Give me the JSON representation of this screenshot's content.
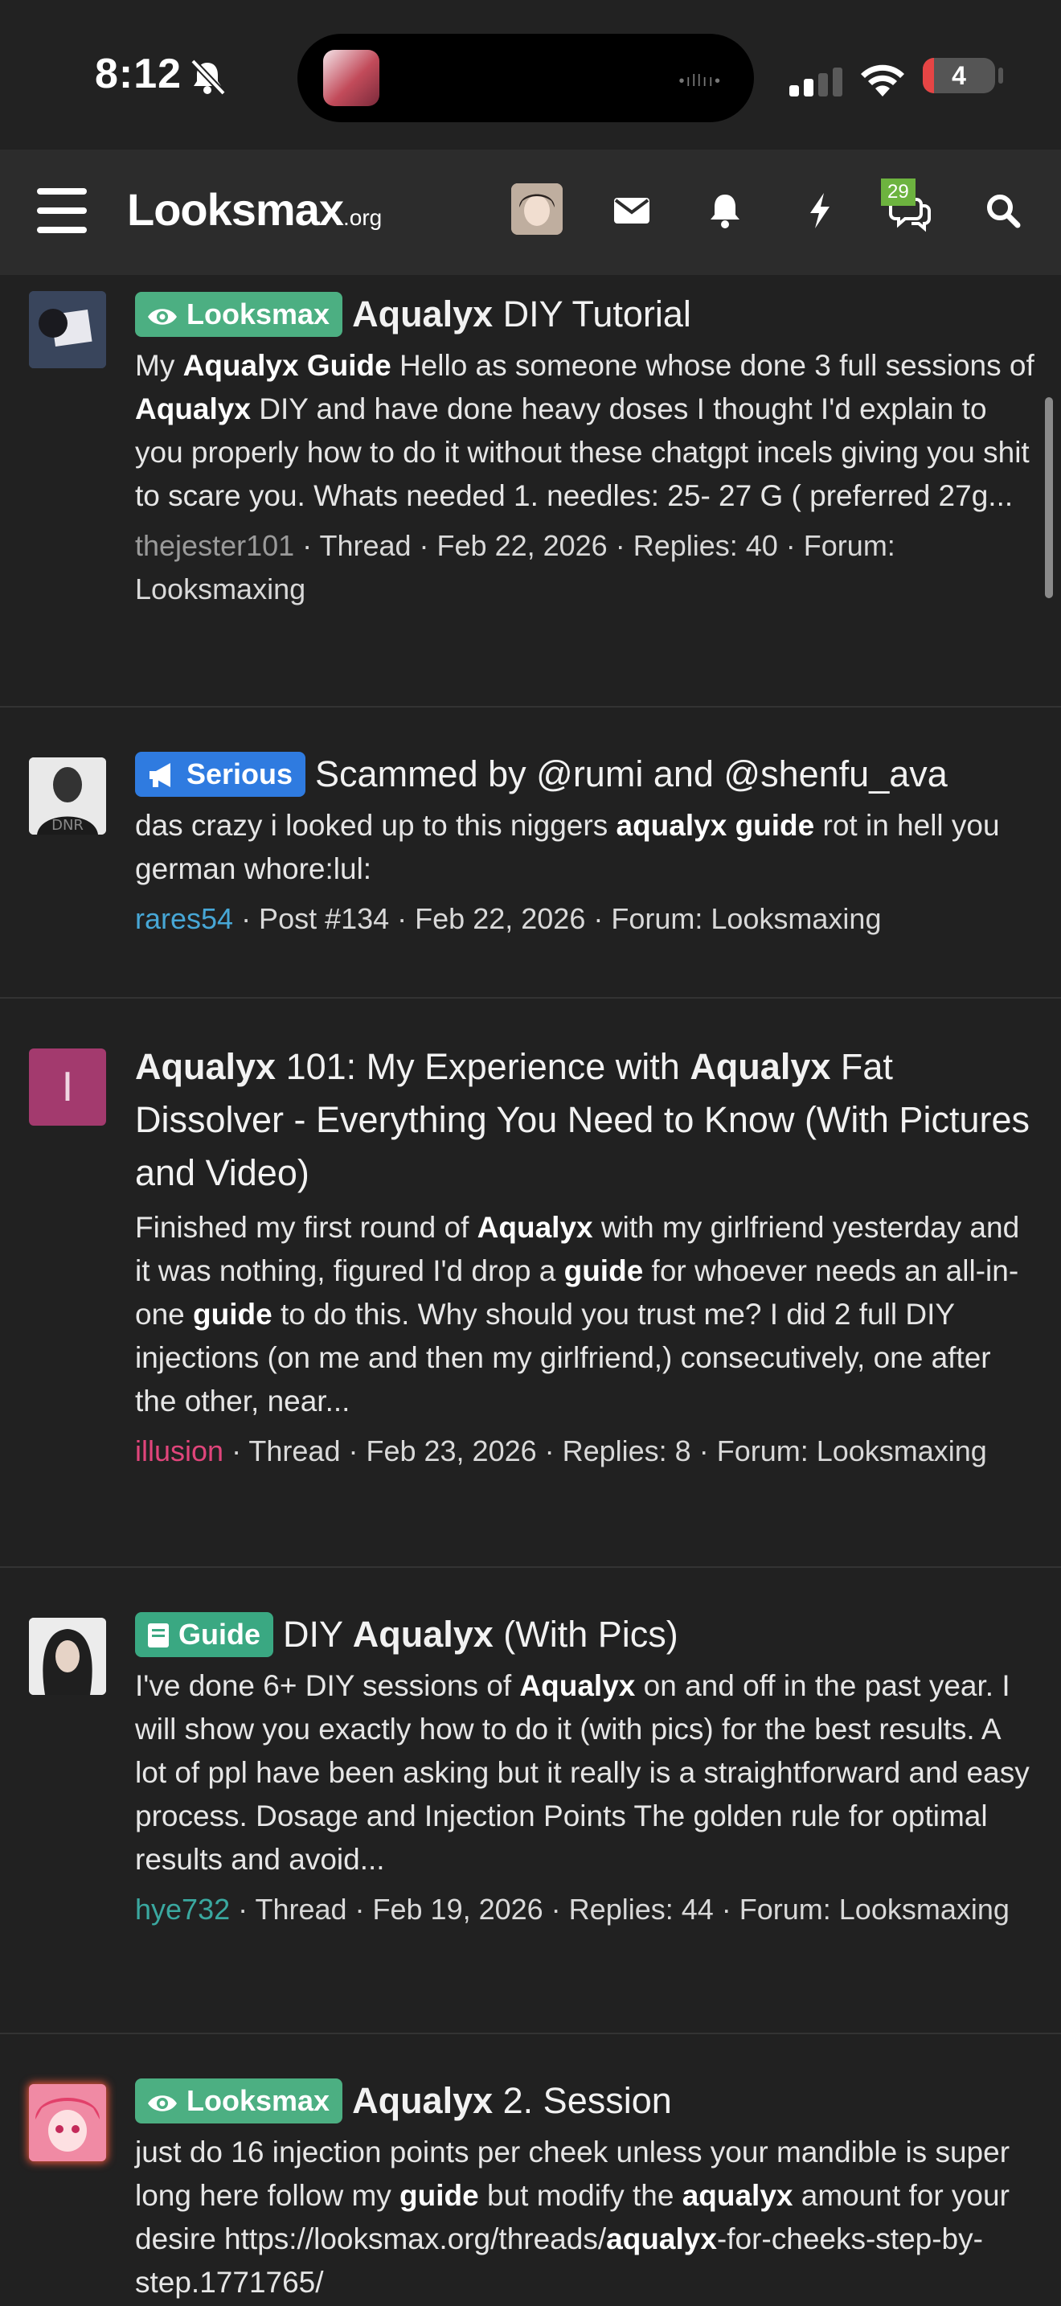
{
  "status_bar": {
    "time": "8:12",
    "battery": "4"
  },
  "navbar": {
    "logo_main": "Looksmax",
    "logo_suffix": ".org",
    "conversations_badge": "29"
  },
  "results": [
    {
      "avatar_color": "#5b6d8c",
      "prefix": {
        "label": "Looksmax",
        "color": "#4caf82",
        "icon": "eye-icon"
      },
      "title_parts": [
        {
          "t": "Aqualyx",
          "b": true
        },
        {
          "t": " DIY Tutorial",
          "b": false
        }
      ],
      "snippet_parts": [
        {
          "t": "My ",
          "b": false
        },
        {
          "t": "Aqualyx Guide",
          "b": true
        },
        {
          "t": " Hello as someone whose done 3 full sessions of ",
          "b": false
        },
        {
          "t": "Aqualyx",
          "b": true
        },
        {
          "t": " DIY and have done heavy doses I thought I'd explain to you properly how to do it without these chatgpt incels giving you shit to scare you. Whats needed 1. needles: 25- 27 G ( preferred 27g...",
          "b": false
        }
      ],
      "author": "thejester101",
      "author_color": "#9a9a9a",
      "meta_rest": " · Thread · Feb 22, 2026 · Replies: 40 · Forum: Looksmaxing"
    },
    {
      "avatar_color": "#dcdcdc",
      "prefix": {
        "label": "Serious",
        "color": "#2f7be0",
        "icon": "megaphone-icon"
      },
      "title_parts": [
        {
          "t": "Scammed by @rumi and @shenfu_ava",
          "b": false
        }
      ],
      "snippet_parts": [
        {
          "t": "das crazy i looked up to this niggers ",
          "b": false
        },
        {
          "t": "aqualyx guide",
          "b": true
        },
        {
          "t": " rot in hell you german whore:lul:",
          "b": false
        }
      ],
      "author": "rares54",
      "author_color": "#47a7d6",
      "meta_rest": " · Post #134 · Feb 22, 2026 · Forum: Looksmaxing"
    },
    {
      "avatar_color": "#a33a6e",
      "avatar_letter": "I",
      "prefix": null,
      "title_parts": [
        {
          "t": "Aqualyx",
          "b": true
        },
        {
          "t": " 101: My Experience with ",
          "b": false
        },
        {
          "t": "Aqualyx",
          "b": true
        },
        {
          "t": " Fat Dissolver - Everything You Need to Know (With Pictures and Video)",
          "b": false
        }
      ],
      "snippet_parts": [
        {
          "t": "Finished my first round of ",
          "b": false
        },
        {
          "t": "Aqualyx",
          "b": true
        },
        {
          "t": " with my girlfriend yesterday and it was nothing, figured I'd drop a ",
          "b": false
        },
        {
          "t": "guide",
          "b": true
        },
        {
          "t": " for whoever needs an all-in-one ",
          "b": false
        },
        {
          "t": "guide",
          "b": true
        },
        {
          "t": " to do this. Why should you trust me? I did 2 full DIY injections (on me and then my girlfriend,) consecutively, one after the other, near...",
          "b": false
        }
      ],
      "author": "illusion",
      "author_color": "#e0457b",
      "meta_rest": " · Thread · Feb 23, 2026 · Replies: 8 · Forum: Looksmaxing"
    },
    {
      "avatar_color": "#e8e8e8",
      "prefix": {
        "label": "Guide",
        "color": "#3aa882",
        "icon": "book-icon"
      },
      "title_parts": [
        {
          "t": "DIY ",
          "b": false
        },
        {
          "t": "Aqualyx",
          "b": true
        },
        {
          "t": " (With Pics)",
          "b": false
        }
      ],
      "snippet_parts": [
        {
          "t": "I've done 6+ DIY sessions of ",
          "b": false
        },
        {
          "t": "Aqualyx",
          "b": true
        },
        {
          "t": " on and off in the past year. I will show you exactly how to do it (with pics) for the best results. A lot of ppl have been asking but it really is a straightforward and easy process. Dosage and Injection Points The golden rule for optimal results and avoid...",
          "b": false
        }
      ],
      "author": "hye732",
      "author_color": "#3aa8a0",
      "meta_rest": " · Thread · Feb 19, 2026 · Replies: 44 · Forum: Looksmaxing"
    },
    {
      "avatar_color": "#e85a7a",
      "prefix": {
        "label": "Looksmax",
        "color": "#4caf82",
        "icon": "eye-icon"
      },
      "title_parts": [
        {
          "t": "Aqualyx",
          "b": true
        },
        {
          "t": " 2. Session",
          "b": false
        }
      ],
      "snippet_parts": [
        {
          "t": "just do 16 injection points per cheek unless your mandible is super long here follow my ",
          "b": false
        },
        {
          "t": "guide",
          "b": true
        },
        {
          "t": " but modify the ",
          "b": false
        },
        {
          "t": "aqualyx",
          "b": true
        },
        {
          "t": " amount for your desire https://looksmax.org/threads/",
          "b": false
        },
        {
          "t": "aqualyx",
          "b": true
        },
        {
          "t": "-for-cheeks-step-by-step.1771765/",
          "b": false
        }
      ],
      "author": "",
      "author_color": "#9a9a9a",
      "meta_rest": ""
    }
  ]
}
